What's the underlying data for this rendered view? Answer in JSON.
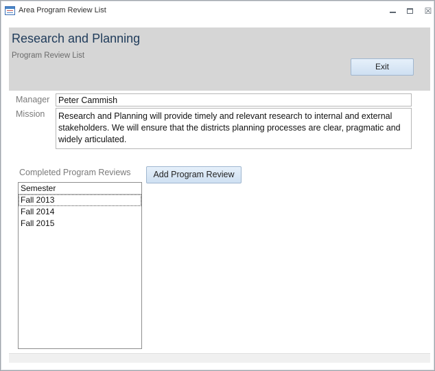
{
  "window": {
    "title": "Area Program Review List",
    "icon": "access-form-icon",
    "controls": {
      "minimize": "minimize-icon",
      "maximize": "maximize-icon",
      "close_glyph": "☒"
    }
  },
  "header": {
    "title": "Research and Planning",
    "subtitle": "Program Review List",
    "exit_label": "Exit"
  },
  "form": {
    "manager_label": "Manager",
    "manager_value": "Peter Cammish",
    "mission_label": "Mission",
    "mission_value": "Research and Planning will provide timely and relevant research to internal and external stakeholders. We will ensure that the districts planning processes are clear, pragmatic and widely articulated."
  },
  "reviews": {
    "label": "Completed Program Reviews",
    "add_button_label": "Add Program Review",
    "column_header": "Semester",
    "items": [
      "Fall 2013",
      "Fall 2014",
      "Fall 2015"
    ],
    "selected_index": 0
  },
  "colors": {
    "header_band": "#d6d6d6",
    "title_text": "#1f3b5a",
    "button_face": "#d9e7f5"
  }
}
